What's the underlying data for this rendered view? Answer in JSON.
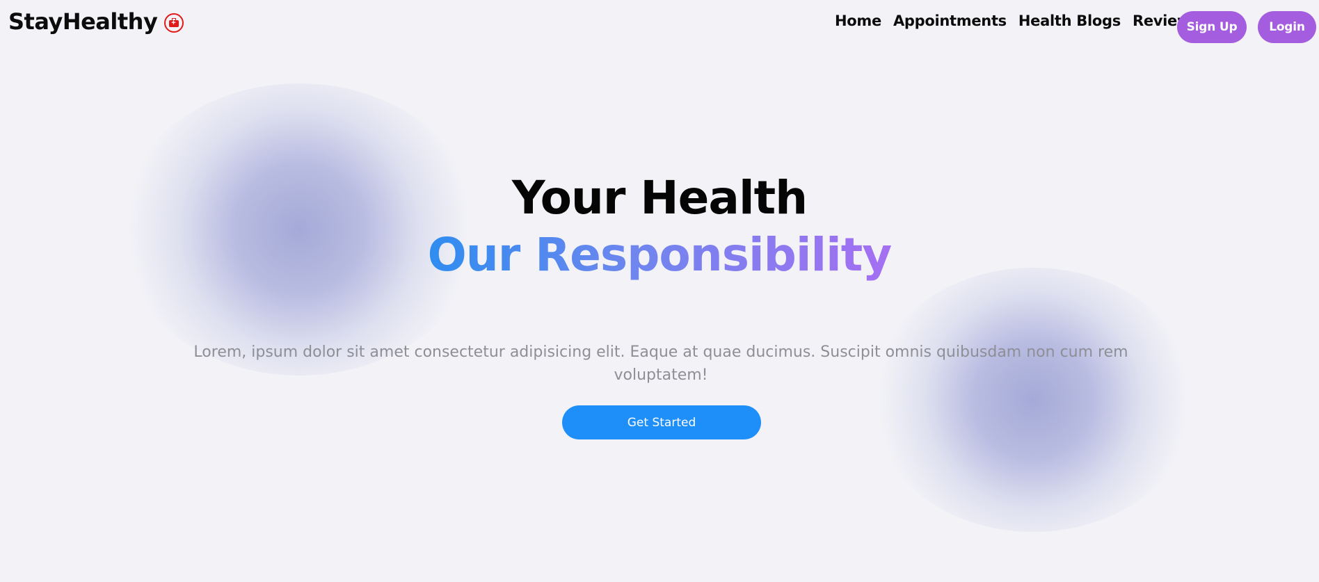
{
  "brand": {
    "name": "StayHealthy",
    "icon": "first-aid-kit-icon",
    "icon_color": "#e11919"
  },
  "nav": {
    "links": [
      {
        "label": "Home"
      },
      {
        "label": "Appointments"
      },
      {
        "label": "Health Blogs"
      },
      {
        "label": "Reviews"
      }
    ],
    "signup_label": "Sign Up",
    "login_label": "Login",
    "button_color": "#a55de0"
  },
  "hero": {
    "title_line1": "Your Health",
    "title_line2": "Our Responsibility",
    "gradient_colors": [
      "#2f8df0",
      "#a56ff2"
    ],
    "description": "Lorem, ipsum dolor sit amet consectetur adipisicing elit. Eaque at quae ducimus. Suscipit omnis quibusdam non cum rem voluptatem!",
    "cta_label": "Get Started",
    "cta_color": "#1e8ff8"
  }
}
